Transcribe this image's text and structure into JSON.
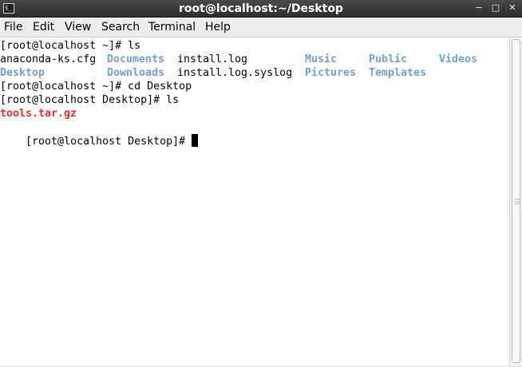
{
  "window": {
    "title": "root@localhost:~/Desktop",
    "app_icon": "terminal-icon",
    "app_icon_glyph": "$_",
    "controls": {
      "minimize_glyph": "−",
      "maximize_glyph": "□",
      "close_glyph": "✕"
    }
  },
  "menu": {
    "file": "File",
    "edit": "Edit",
    "view": "View",
    "search": "Search",
    "terminal": "Terminal",
    "help": "Help"
  },
  "terminal": {
    "line1": "[root@localhost ~]# ls",
    "ls_home": {
      "row1": [
        "anaconda-ks.cfg",
        "Documents",
        "install.log",
        "Music",
        "Public",
        "Videos"
      ],
      "row2": [
        "Desktop",
        "Downloads",
        "install.log.syslog",
        "Pictures",
        "Templates"
      ]
    },
    "line4": "[root@localhost ~]# cd Desktop",
    "line5": "[root@localhost Desktop]# ls",
    "archive": "tools.tar.gz",
    "prompt": "[root@localhost Desktop]#"
  },
  "colors": {
    "directory": "#729fcf",
    "archive": "#ef2929",
    "titlebar": "#3a3a3a",
    "menubar": "#ededed"
  }
}
